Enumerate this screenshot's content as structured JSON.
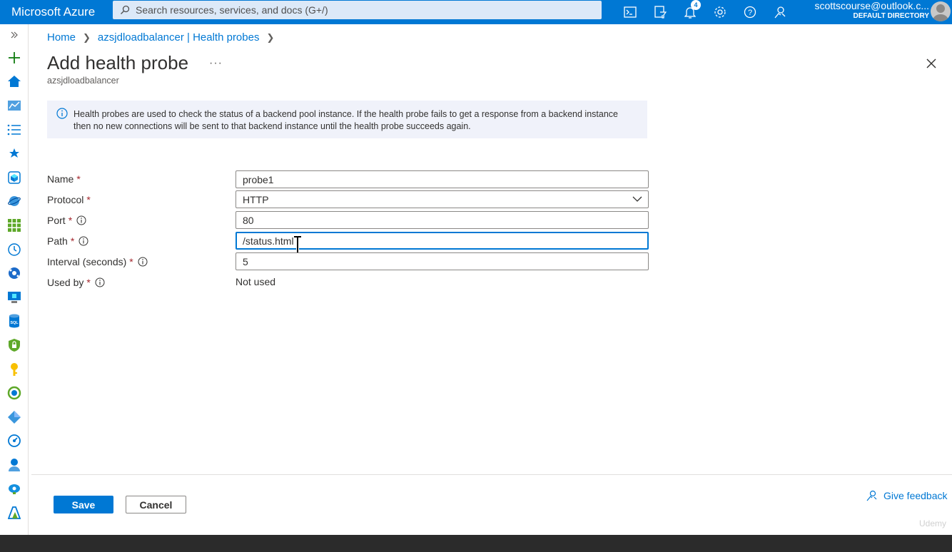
{
  "topbar": {
    "brand": "Microsoft Azure",
    "search_placeholder": "Search resources, services, and docs (G+/)",
    "notifications_count": "4",
    "account_email": "scottscourse@outlook.c...",
    "account_directory": "DEFAULT DIRECTORY",
    "icons": [
      "cloud-shell-icon",
      "directory-filter-icon",
      "bell-icon",
      "gear-icon",
      "help-icon",
      "feedback-person-icon"
    ]
  },
  "sidebar": {
    "icons": [
      "expand-icon",
      "create-plus-icon",
      "home-icon",
      "dashboard-icon",
      "all-services-icon",
      "favorites-star-icon",
      "resource-groups-icon",
      "app-services-icon",
      "all-resources-icon",
      "recent-clock-icon",
      "cosmos-db-icon",
      "virtual-machines-icon",
      "sql-database-icon",
      "security-shield-icon",
      "key-vault-icon",
      "monitor-icon",
      "devops-icon",
      "advisor-icon",
      "users-icon",
      "cloud-icon",
      "azure-logo-icon"
    ]
  },
  "breadcrumb": {
    "home": "Home",
    "parent": "azsjdloadbalancer | Health probes"
  },
  "header": {
    "title": "Add health probe",
    "more": "···",
    "subtitle": "azsjdloadbalancer"
  },
  "info": {
    "line1": "Health probes are used to check the status of a backend pool instance. If the health probe fails to get a response from a backend instance",
    "line2": "then no new connections will be sent to that backend instance until the health probe succeeds again."
  },
  "form": {
    "name_label": "Name",
    "name_value": "probe1",
    "protocol_label": "Protocol",
    "protocol_value": "HTTP",
    "port_label": "Port",
    "port_value": "80",
    "path_label": "Path",
    "path_value": "/status.html",
    "interval_label": "Interval (seconds)",
    "interval_value": "5",
    "used_by_label": "Used by",
    "used_by_value": "Not used",
    "required_mark": "*"
  },
  "footer": {
    "save": "Save",
    "cancel": "Cancel",
    "feedback": "Give feedback"
  },
  "watermark": "Udemy",
  "colors": {
    "accent": "#0078d4",
    "info_bg": "#f0f2fa",
    "required": "#a4262c"
  }
}
